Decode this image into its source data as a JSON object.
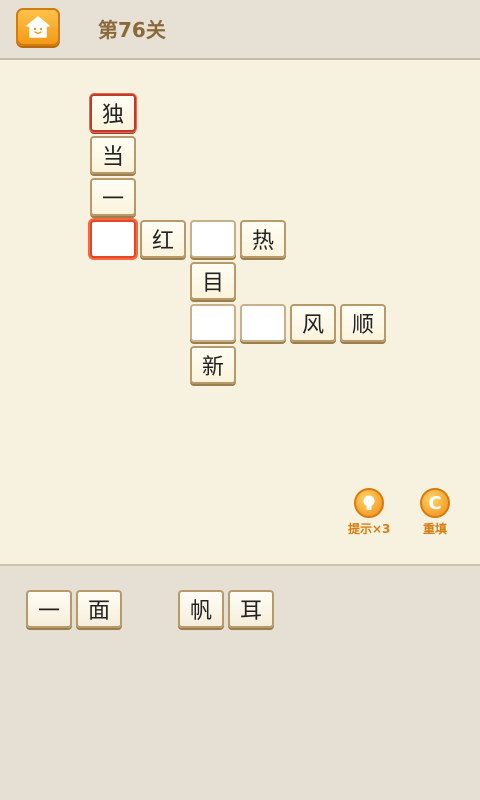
{
  "header": {
    "level_title": "第76关",
    "home_icon": "home-icon",
    "accent": "#f39a16"
  },
  "board": {
    "cells": [
      {
        "id": "c-du",
        "char": "独"
      },
      {
        "id": "c-dang",
        "char": "当"
      },
      {
        "id": "c-yi",
        "char": "一"
      },
      {
        "id": "c-sel",
        "char": ""
      },
      {
        "id": "c-hong",
        "char": "红"
      },
      {
        "id": "c-blank2",
        "char": ""
      },
      {
        "id": "c-re",
        "char": "热"
      },
      {
        "id": "c-mu",
        "char": "目"
      },
      {
        "id": "c-blank3",
        "char": ""
      },
      {
        "id": "c-blank4",
        "char": ""
      },
      {
        "id": "c-feng",
        "char": "风"
      },
      {
        "id": "c-shun",
        "char": "顺"
      },
      {
        "id": "c-xin",
        "char": "新"
      }
    ]
  },
  "tools": {
    "hint_label": "提示×3",
    "reset_label": "重填",
    "reset_glyph": "C"
  },
  "tray": {
    "tiles": [
      "一",
      "面",
      "帆",
      "耳"
    ]
  }
}
